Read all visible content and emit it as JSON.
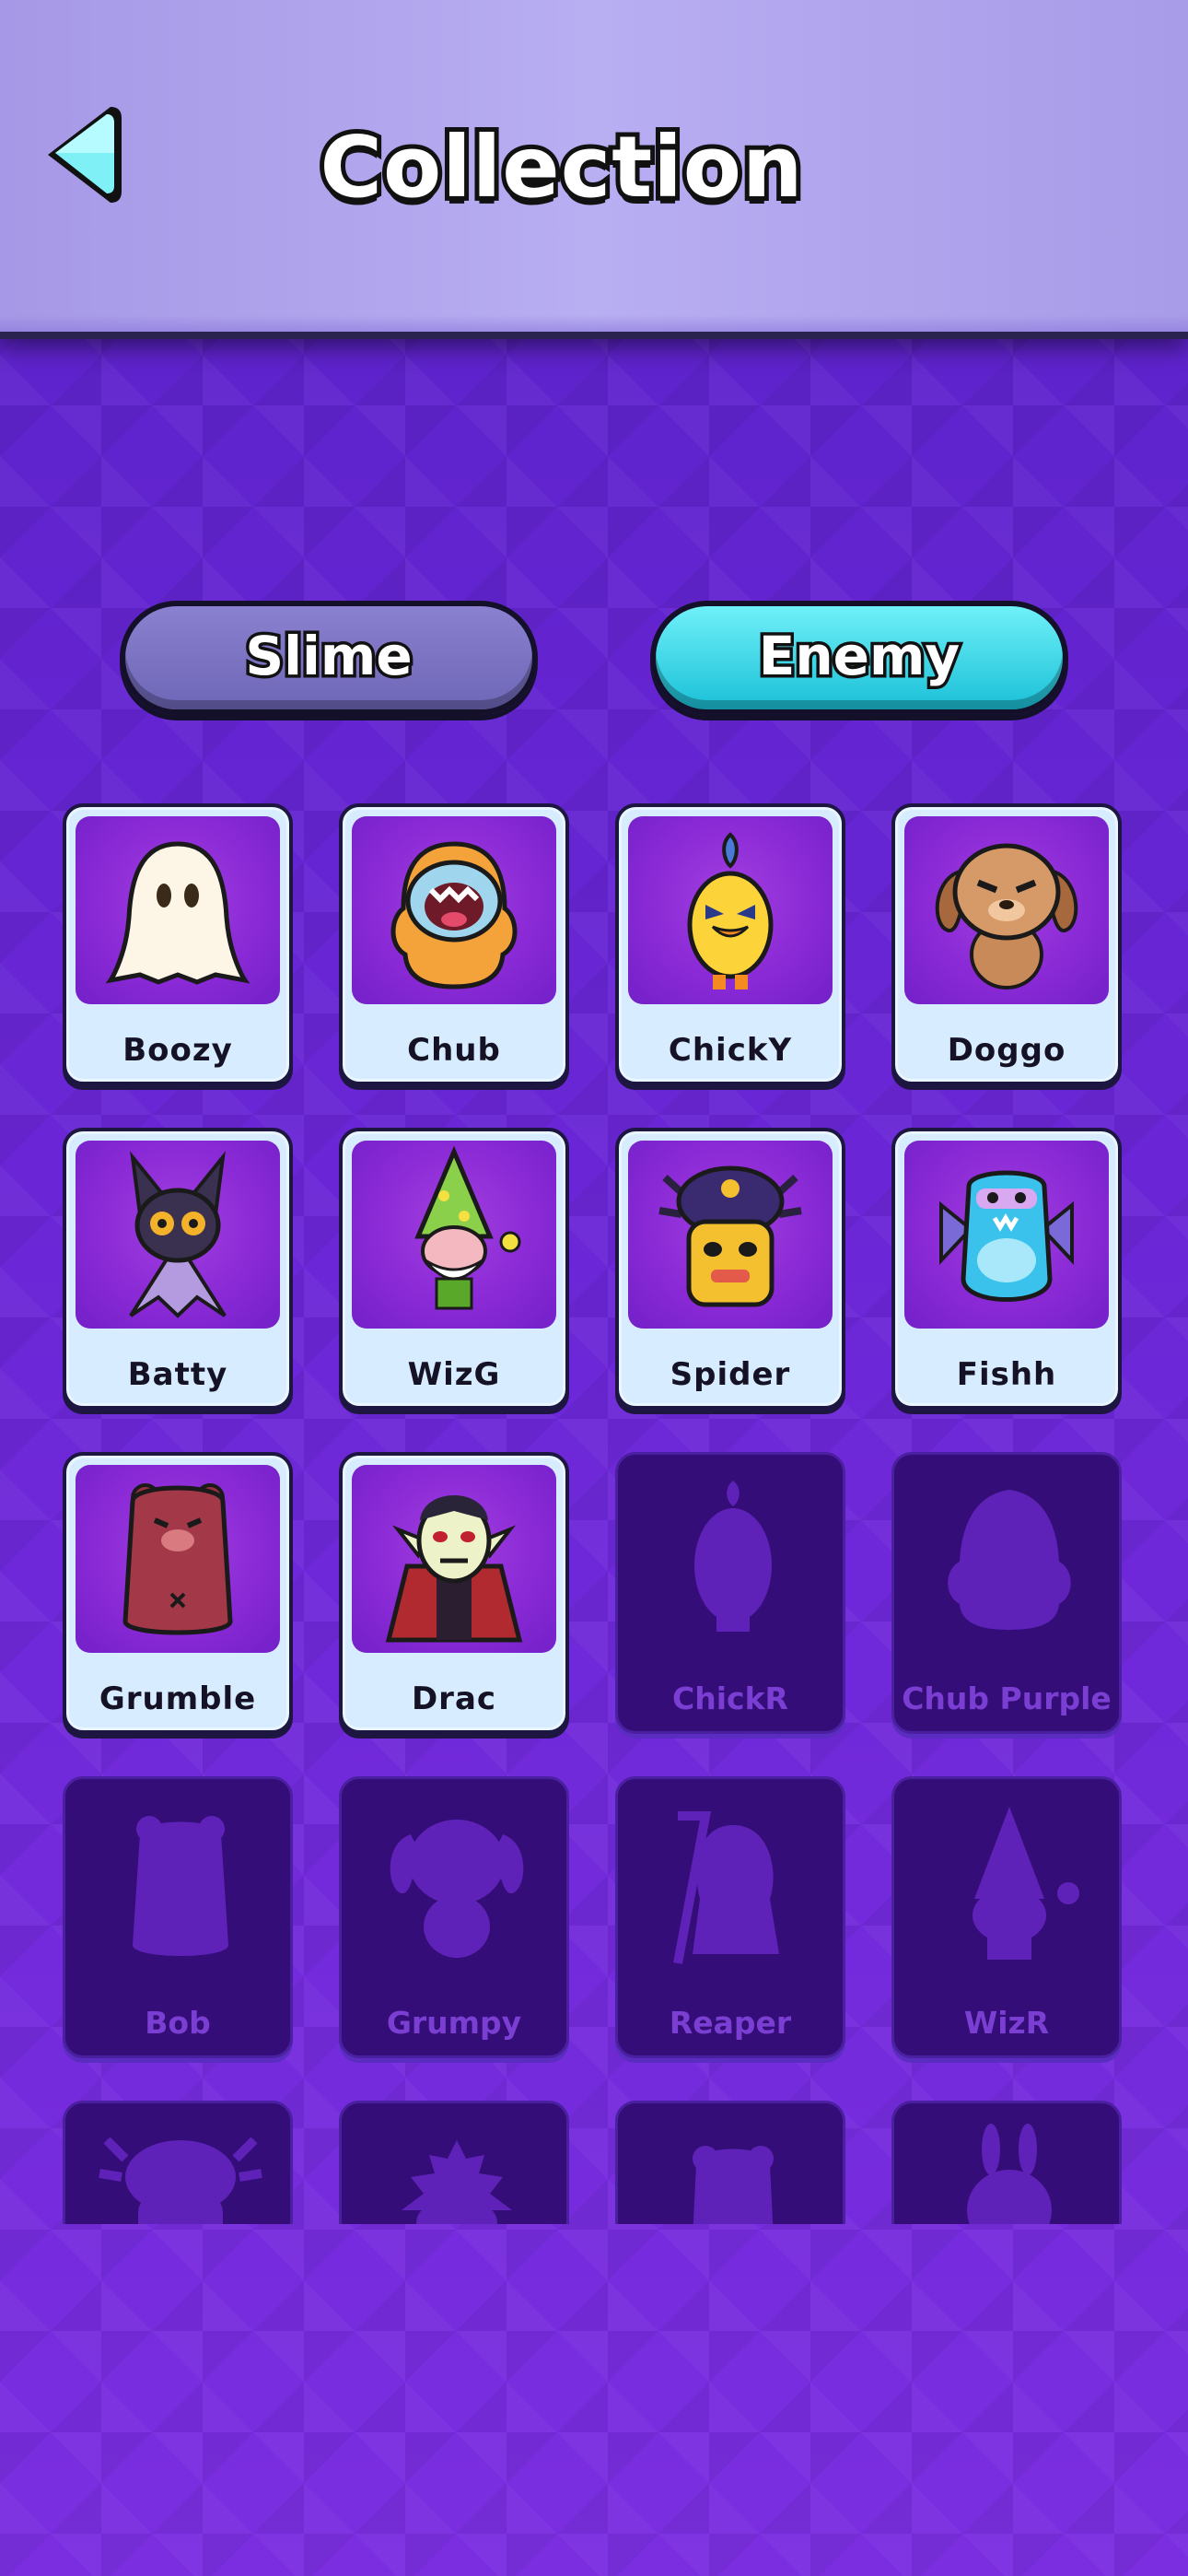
{
  "header": {
    "title": "Collection",
    "back_icon": "back-arrow-icon"
  },
  "tabs": [
    {
      "label": "Slime",
      "active": false,
      "color": "#7a72c2"
    },
    {
      "label": "Enemy",
      "active": true,
      "color": "#2cd4e6"
    }
  ],
  "cards": [
    {
      "name": "Boozy",
      "unlocked": true,
      "icon": "ghost"
    },
    {
      "name": "Chub",
      "unlocked": true,
      "icon": "orange-chub"
    },
    {
      "name": "ChickY",
      "unlocked": true,
      "icon": "yellow-chick"
    },
    {
      "name": "Doggo",
      "unlocked": true,
      "icon": "dog"
    },
    {
      "name": "Batty",
      "unlocked": true,
      "icon": "bat"
    },
    {
      "name": "WizG",
      "unlocked": true,
      "icon": "wizard-gnome"
    },
    {
      "name": "Spider",
      "unlocked": true,
      "icon": "spider-mask"
    },
    {
      "name": "Fishh",
      "unlocked": true,
      "icon": "blue-fish"
    },
    {
      "name": "Grumble",
      "unlocked": true,
      "icon": "bear"
    },
    {
      "name": "Drac",
      "unlocked": true,
      "icon": "vampire"
    },
    {
      "name": "ChickR",
      "unlocked": false,
      "icon": "chick-silhouette"
    },
    {
      "name": "Chub Purple",
      "unlocked": false,
      "icon": "chub-silhouette"
    },
    {
      "name": "Bob",
      "unlocked": false,
      "icon": "bear-silhouette"
    },
    {
      "name": "Grumpy",
      "unlocked": false,
      "icon": "dog-silhouette"
    },
    {
      "name": "Reaper",
      "unlocked": false,
      "icon": "reaper-silhouette"
    },
    {
      "name": "WizR",
      "unlocked": false,
      "icon": "wizard-silhouette"
    },
    {
      "name": "",
      "unlocked": false,
      "icon": "spider-silhouette"
    },
    {
      "name": "",
      "unlocked": false,
      "icon": "plant-silhouette"
    },
    {
      "name": "",
      "unlocked": false,
      "icon": "blob-silhouette"
    },
    {
      "name": "",
      "unlocked": false,
      "icon": "bunny-silhouette"
    }
  ],
  "colors": {
    "background": "#6a26d6",
    "card_unlocked": "#d8ecff",
    "card_locked": "#350d78",
    "locked_text": "#7a3fd2"
  }
}
